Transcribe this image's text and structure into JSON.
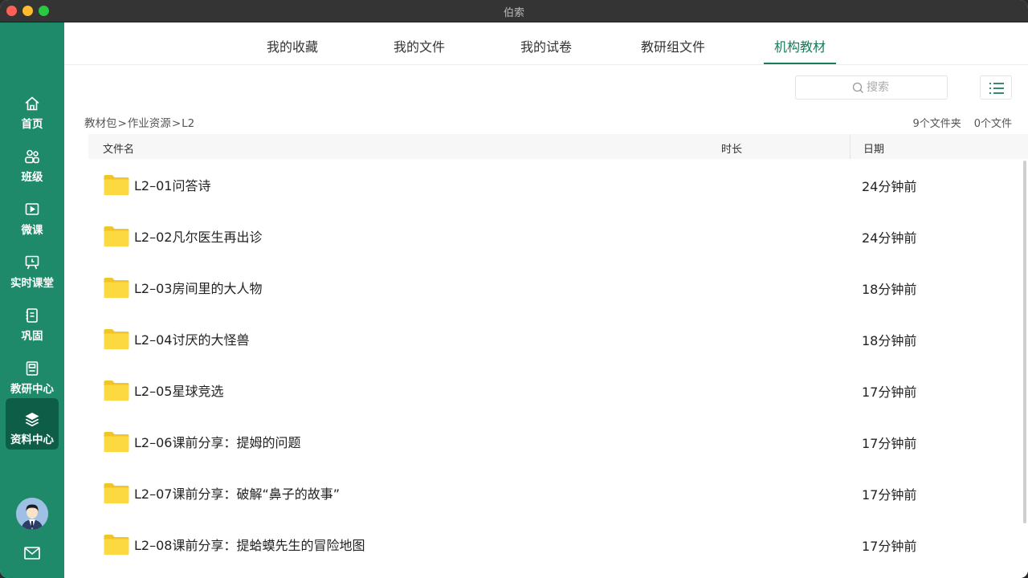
{
  "window": {
    "title": "伯索"
  },
  "sidebar": {
    "items": [
      {
        "label": "首页",
        "icon": "home-icon"
      },
      {
        "label": "班级",
        "icon": "users-icon"
      },
      {
        "label": "微课",
        "icon": "play-icon"
      },
      {
        "label": "实时课堂",
        "icon": "board-icon"
      },
      {
        "label": "巩固",
        "icon": "notebook-icon"
      },
      {
        "label": "教研中心",
        "icon": "book-icon"
      },
      {
        "label": "资料中心",
        "icon": "layers-icon",
        "active": true
      }
    ]
  },
  "tabs": [
    {
      "label": "我的收藏"
    },
    {
      "label": "我的文件"
    },
    {
      "label": "我的试卷"
    },
    {
      "label": "教研组文件"
    },
    {
      "label": "机构教材",
      "active": true
    }
  ],
  "search": {
    "placeholder": "搜索"
  },
  "breadcrumb": [
    "教材包",
    "作业资源",
    "L2"
  ],
  "counts": {
    "folders": "9个文件夹",
    "files": "0个文件"
  },
  "table": {
    "headers": {
      "name": "文件名",
      "duration": "时长",
      "date": "日期"
    },
    "rows": [
      {
        "name": "L2–01问答诗",
        "date": "24分钟前"
      },
      {
        "name": "L2–02凡尔医生再出诊",
        "date": "24分钟前"
      },
      {
        "name": "L2–03房间里的大人物",
        "date": "18分钟前"
      },
      {
        "name": "L2–04讨厌的大怪兽",
        "date": "18分钟前"
      },
      {
        "name": "L2–05星球竞选",
        "date": "17分钟前"
      },
      {
        "name": "L2–06课前分享：提姆的问题",
        "date": "17分钟前"
      },
      {
        "name": "L2–07课前分享：破解“鼻子的故事”",
        "date": "17分钟前"
      },
      {
        "name": "L2–08课前分享：提蛤蟆先生的冒险地图",
        "date": "17分钟前"
      }
    ]
  },
  "colors": {
    "sidebar": "#1e8a6a",
    "sidebar_active": "#0d5d47",
    "accent": "#1a7a5c",
    "folder": "#f9d33a"
  }
}
